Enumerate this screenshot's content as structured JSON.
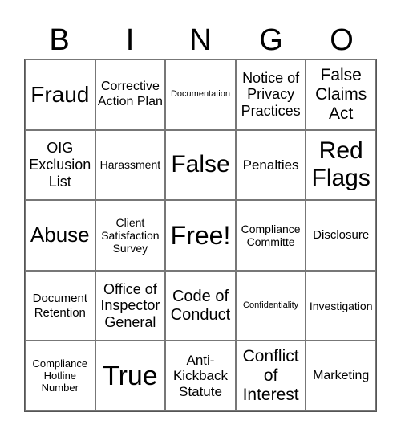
{
  "header": [
    "B",
    "I",
    "N",
    "G",
    "O"
  ],
  "cells": [
    "Fraud",
    "Corrective Action Plan",
    "Documentation",
    "Notice of Privacy Practices",
    "False Claims Act",
    "OIG Exclusion List",
    "Harassment",
    "False",
    "Penalties",
    "Red Flags",
    "Abuse",
    "Client Satisfaction Survey",
    "Free!",
    "Compliance Committe",
    "Disclosure",
    "Document Retention",
    "Office of Inspector General",
    "Code of Conduct",
    "Confidentiality",
    "Investigation",
    "Compliance Hotline Number",
    "True",
    "Anti-Kickback Statute",
    "Conflict of Interest",
    "Marketing"
  ]
}
